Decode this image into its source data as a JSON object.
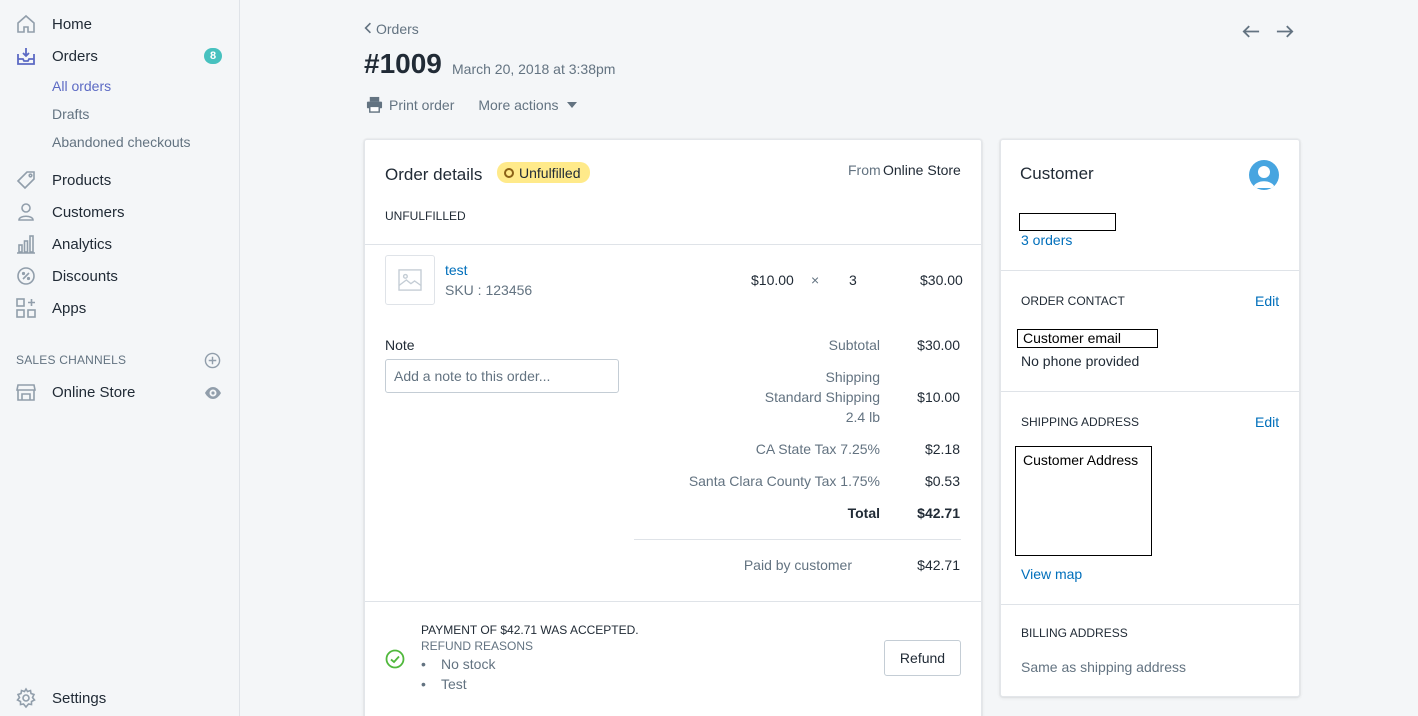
{
  "sidebar": {
    "items": [
      {
        "label": "Home",
        "icon": "home-icon"
      },
      {
        "label": "Orders",
        "icon": "orders-icon",
        "badge": "8"
      },
      {
        "label": "Products",
        "icon": "tag-icon"
      },
      {
        "label": "Customers",
        "icon": "person-icon"
      },
      {
        "label": "Analytics",
        "icon": "bar-chart-icon"
      },
      {
        "label": "Discounts",
        "icon": "discount-icon"
      },
      {
        "label": "Apps",
        "icon": "apps-icon"
      }
    ],
    "orders_sub": [
      "All orders",
      "Drafts",
      "Abandoned checkouts"
    ],
    "sales_channels_title": "SALES CHANNELS",
    "online_store": "Online Store",
    "settings": "Settings"
  },
  "header": {
    "breadcrumb": "Orders",
    "order_number": "#1009",
    "date": "March 20, 2018 at 3:38pm",
    "print_label": "Print order",
    "more_actions_label": "More actions"
  },
  "order": {
    "title": "Order details",
    "status_badge": "Unfulfilled",
    "source_prefix": "From",
    "source": "Online Store",
    "section_label": "UNFULFILLED",
    "line_item": {
      "name": "test",
      "sku": "SKU : 123456",
      "price": "$10.00",
      "times": "×",
      "quantity": "3",
      "total": "$30.00"
    },
    "note_label": "Note",
    "note_placeholder": "Add a note to this order...",
    "summary": {
      "subtotal_label": "Subtotal",
      "subtotal_value": "$30.00",
      "shipping_label": "Shipping",
      "shipping_method": "Standard Shipping",
      "shipping_weight": "2.4 lb",
      "shipping_value": "$10.00",
      "tax1_label": "CA State Tax 7.25%",
      "tax1_value": "$2.18",
      "tax2_label": "Santa Clara County Tax 1.75%",
      "tax2_value": "$0.53",
      "total_label": "Total",
      "total_value": "$42.71",
      "paid_label": "Paid by customer",
      "paid_value": "$42.71"
    },
    "payment": {
      "accepted_text": "PAYMENT OF $42.71 WAS ACCEPTED.",
      "refund_reasons_title": "REFUND REASONS",
      "reasons": [
        "No stock",
        "Test"
      ],
      "refund_button": "Refund"
    }
  },
  "customer": {
    "title": "Customer",
    "orders_link": "3 orders",
    "contact_title": "ORDER CONTACT",
    "edit_label": "Edit",
    "email": "Customer email",
    "phone": "No phone provided",
    "shipping_title": "SHIPPING ADDRESS",
    "shipping_address": "Customer Address",
    "view_map": "View map",
    "billing_title": "BILLING ADDRESS",
    "billing_text": "Same as shipping address"
  },
  "colors": {
    "accent": "#5c6ac4",
    "link": "#006fbb",
    "badge_teal": "#47c1bf",
    "unfulfilled_yellow": "#ffea8a",
    "success_green": "#50b83c"
  }
}
